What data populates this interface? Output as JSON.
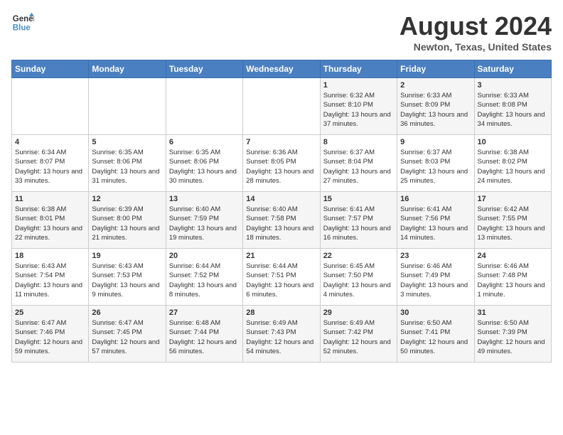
{
  "header": {
    "logo_line1": "General",
    "logo_line2": "Blue",
    "month_year": "August 2024",
    "location": "Newton, Texas, United States"
  },
  "weekdays": [
    "Sunday",
    "Monday",
    "Tuesday",
    "Wednesday",
    "Thursday",
    "Friday",
    "Saturday"
  ],
  "weeks": [
    [
      {
        "day": "",
        "sunrise": "",
        "sunset": "",
        "daylight": ""
      },
      {
        "day": "",
        "sunrise": "",
        "sunset": "",
        "daylight": ""
      },
      {
        "day": "",
        "sunrise": "",
        "sunset": "",
        "daylight": ""
      },
      {
        "day": "",
        "sunrise": "",
        "sunset": "",
        "daylight": ""
      },
      {
        "day": "1",
        "sunrise": "Sunrise: 6:32 AM",
        "sunset": "Sunset: 8:10 PM",
        "daylight": "Daylight: 13 hours and 37 minutes."
      },
      {
        "day": "2",
        "sunrise": "Sunrise: 6:33 AM",
        "sunset": "Sunset: 8:09 PM",
        "daylight": "Daylight: 13 hours and 36 minutes."
      },
      {
        "day": "3",
        "sunrise": "Sunrise: 6:33 AM",
        "sunset": "Sunset: 8:08 PM",
        "daylight": "Daylight: 13 hours and 34 minutes."
      }
    ],
    [
      {
        "day": "4",
        "sunrise": "Sunrise: 6:34 AM",
        "sunset": "Sunset: 8:07 PM",
        "daylight": "Daylight: 13 hours and 33 minutes."
      },
      {
        "day": "5",
        "sunrise": "Sunrise: 6:35 AM",
        "sunset": "Sunset: 8:06 PM",
        "daylight": "Daylight: 13 hours and 31 minutes."
      },
      {
        "day": "6",
        "sunrise": "Sunrise: 6:35 AM",
        "sunset": "Sunset: 8:06 PM",
        "daylight": "Daylight: 13 hours and 30 minutes."
      },
      {
        "day": "7",
        "sunrise": "Sunrise: 6:36 AM",
        "sunset": "Sunset: 8:05 PM",
        "daylight": "Daylight: 13 hours and 28 minutes."
      },
      {
        "day": "8",
        "sunrise": "Sunrise: 6:37 AM",
        "sunset": "Sunset: 8:04 PM",
        "daylight": "Daylight: 13 hours and 27 minutes."
      },
      {
        "day": "9",
        "sunrise": "Sunrise: 6:37 AM",
        "sunset": "Sunset: 8:03 PM",
        "daylight": "Daylight: 13 hours and 25 minutes."
      },
      {
        "day": "10",
        "sunrise": "Sunrise: 6:38 AM",
        "sunset": "Sunset: 8:02 PM",
        "daylight": "Daylight: 13 hours and 24 minutes."
      }
    ],
    [
      {
        "day": "11",
        "sunrise": "Sunrise: 6:38 AM",
        "sunset": "Sunset: 8:01 PM",
        "daylight": "Daylight: 13 hours and 22 minutes."
      },
      {
        "day": "12",
        "sunrise": "Sunrise: 6:39 AM",
        "sunset": "Sunset: 8:00 PM",
        "daylight": "Daylight: 13 hours and 21 minutes."
      },
      {
        "day": "13",
        "sunrise": "Sunrise: 6:40 AM",
        "sunset": "Sunset: 7:59 PM",
        "daylight": "Daylight: 13 hours and 19 minutes."
      },
      {
        "day": "14",
        "sunrise": "Sunrise: 6:40 AM",
        "sunset": "Sunset: 7:58 PM",
        "daylight": "Daylight: 13 hours and 18 minutes."
      },
      {
        "day": "15",
        "sunrise": "Sunrise: 6:41 AM",
        "sunset": "Sunset: 7:57 PM",
        "daylight": "Daylight: 13 hours and 16 minutes."
      },
      {
        "day": "16",
        "sunrise": "Sunrise: 6:41 AM",
        "sunset": "Sunset: 7:56 PM",
        "daylight": "Daylight: 13 hours and 14 minutes."
      },
      {
        "day": "17",
        "sunrise": "Sunrise: 6:42 AM",
        "sunset": "Sunset: 7:55 PM",
        "daylight": "Daylight: 13 hours and 13 minutes."
      }
    ],
    [
      {
        "day": "18",
        "sunrise": "Sunrise: 6:43 AM",
        "sunset": "Sunset: 7:54 PM",
        "daylight": "Daylight: 13 hours and 11 minutes."
      },
      {
        "day": "19",
        "sunrise": "Sunrise: 6:43 AM",
        "sunset": "Sunset: 7:53 PM",
        "daylight": "Daylight: 13 hours and 9 minutes."
      },
      {
        "day": "20",
        "sunrise": "Sunrise: 6:44 AM",
        "sunset": "Sunset: 7:52 PM",
        "daylight": "Daylight: 13 hours and 8 minutes."
      },
      {
        "day": "21",
        "sunrise": "Sunrise: 6:44 AM",
        "sunset": "Sunset: 7:51 PM",
        "daylight": "Daylight: 13 hours and 6 minutes."
      },
      {
        "day": "22",
        "sunrise": "Sunrise: 6:45 AM",
        "sunset": "Sunset: 7:50 PM",
        "daylight": "Daylight: 13 hours and 4 minutes."
      },
      {
        "day": "23",
        "sunrise": "Sunrise: 6:46 AM",
        "sunset": "Sunset: 7:49 PM",
        "daylight": "Daylight: 13 hours and 3 minutes."
      },
      {
        "day": "24",
        "sunrise": "Sunrise: 6:46 AM",
        "sunset": "Sunset: 7:48 PM",
        "daylight": "Daylight: 13 hours and 1 minute."
      }
    ],
    [
      {
        "day": "25",
        "sunrise": "Sunrise: 6:47 AM",
        "sunset": "Sunset: 7:46 PM",
        "daylight": "Daylight: 12 hours and 59 minutes."
      },
      {
        "day": "26",
        "sunrise": "Sunrise: 6:47 AM",
        "sunset": "Sunset: 7:45 PM",
        "daylight": "Daylight: 12 hours and 57 minutes."
      },
      {
        "day": "27",
        "sunrise": "Sunrise: 6:48 AM",
        "sunset": "Sunset: 7:44 PM",
        "daylight": "Daylight: 12 hours and 56 minutes."
      },
      {
        "day": "28",
        "sunrise": "Sunrise: 6:49 AM",
        "sunset": "Sunset: 7:43 PM",
        "daylight": "Daylight: 12 hours and 54 minutes."
      },
      {
        "day": "29",
        "sunrise": "Sunrise: 6:49 AM",
        "sunset": "Sunset: 7:42 PM",
        "daylight": "Daylight: 12 hours and 52 minutes."
      },
      {
        "day": "30",
        "sunrise": "Sunrise: 6:50 AM",
        "sunset": "Sunset: 7:41 PM",
        "daylight": "Daylight: 12 hours and 50 minutes."
      },
      {
        "day": "31",
        "sunrise": "Sunrise: 6:50 AM",
        "sunset": "Sunset: 7:39 PM",
        "daylight": "Daylight: 12 hours and 49 minutes."
      }
    ]
  ]
}
